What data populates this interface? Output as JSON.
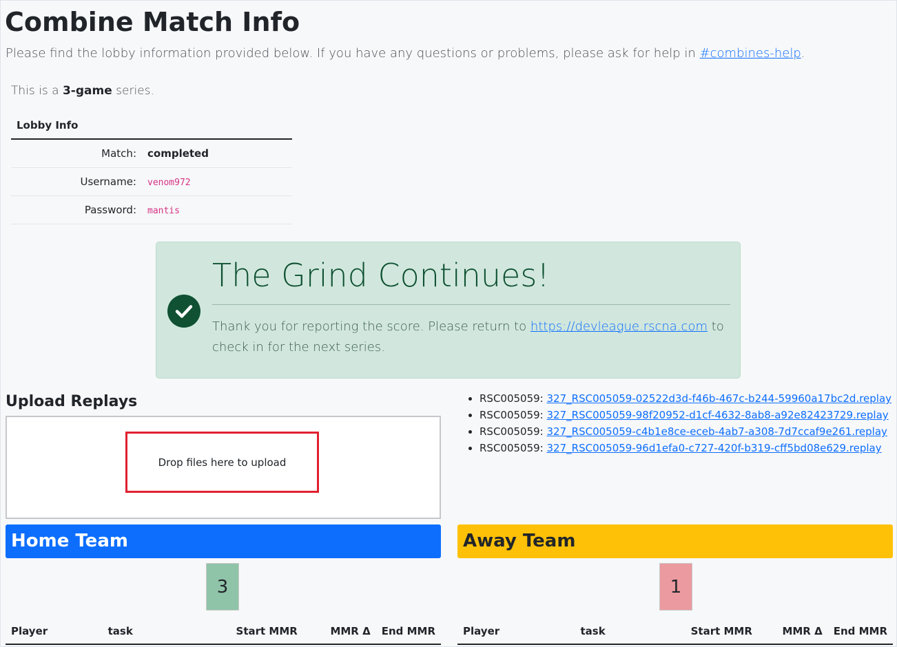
{
  "page": {
    "title": "Combine Match Info",
    "lead_text": "Please find the lobby information provided below. If you have any questions or problems, please ask for help in ",
    "lead_link": "#combines-help",
    "lead_end": "."
  },
  "series": {
    "prefix": "This is a ",
    "count": "3-game",
    "suffix": " series."
  },
  "lobby": {
    "header": "Lobby Info",
    "rows": [
      {
        "label": "Match:",
        "value": "completed"
      },
      {
        "label": "Username:",
        "value": "venom972"
      },
      {
        "label": "Password:",
        "value": "mantis"
      }
    ]
  },
  "alert": {
    "heading": "The Grind Continues!",
    "text_before": "Thank you for reporting the score. Please return to ",
    "link": "https://devleague.rscna.com",
    "text_after": " to check in for the next series.",
    "icon": "check-circle-icon"
  },
  "upload": {
    "title": "Upload Replays",
    "drop_message": "Drop files here to upload"
  },
  "replays": [
    {
      "prefix": "RSC005059:",
      "file": "327_RSC005059-02522d3d-f46b-467c-b244-59960a17bc2d.replay"
    },
    {
      "prefix": "RSC005059:",
      "file": "327_RSC005059-98f20952-d1cf-4632-8ab8-a92e82423729.replay"
    },
    {
      "prefix": "RSC005059:",
      "file": "327_RSC005059-c4b1e8ce-eceb-4ab7-a308-7d7ccaf9e261.replay"
    },
    {
      "prefix": "RSC005059:",
      "file": "327_RSC005059-96d1efa0-c727-420f-b319-cff5bd08e629.replay"
    }
  ],
  "home": {
    "title": "Home Team",
    "score": "3",
    "columns": [
      "Player",
      "task",
      "Start MMR",
      "MMR Δ",
      "End MMR"
    ],
    "color": "#0d6efd"
  },
  "away": {
    "title": "Away Team",
    "score": "1",
    "columns": [
      "Player",
      "task",
      "Start MMR",
      "MMR Δ",
      "End MMR"
    ],
    "color": "#ffc107"
  }
}
